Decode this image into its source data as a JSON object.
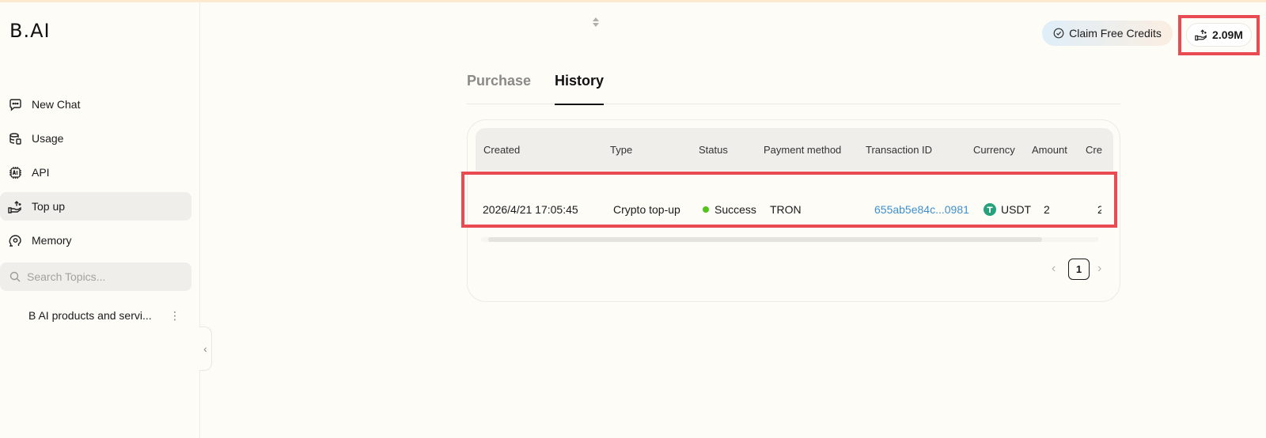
{
  "app": {
    "logo_text": "B.AI"
  },
  "sidebar": {
    "items": [
      {
        "label": "New Chat",
        "icon": "chat-icon",
        "active": false
      },
      {
        "label": "Usage",
        "icon": "usage-icon",
        "active": false
      },
      {
        "label": "API",
        "icon": "api-chip-icon",
        "active": false
      },
      {
        "label": "Top up",
        "icon": "top-up-icon",
        "active": true
      },
      {
        "label": "Memory",
        "icon": "memory-icon",
        "active": false
      }
    ],
    "search_placeholder": "Search Topics...",
    "topics": [
      {
        "label": "B AI products and servi..."
      }
    ]
  },
  "header": {
    "claim_label": "Claim Free Credits",
    "credits_value": "2.09M"
  },
  "tabs": [
    {
      "label": "Purchase",
      "active": false
    },
    {
      "label": "History",
      "active": true
    }
  ],
  "table": {
    "columns": [
      "Created",
      "Type",
      "Status",
      "Payment method",
      "Transaction ID",
      "Currency",
      "Amount",
      "Cre"
    ],
    "rows": [
      {
        "created": "2026/4/21 17:05:45",
        "type": "Crypto top-up",
        "status": "Success",
        "payment_method": "TRON",
        "transaction_id": "655ab5e84c...0981",
        "currency": "USDT",
        "amount": "2",
        "credits_partial": "2"
      }
    ]
  },
  "pagination": {
    "current_page": "1"
  },
  "colors": {
    "accent_highlight": "#e84c52",
    "success": "#52c41a",
    "link": "#3f8fce",
    "usdt": "#26a17b"
  }
}
